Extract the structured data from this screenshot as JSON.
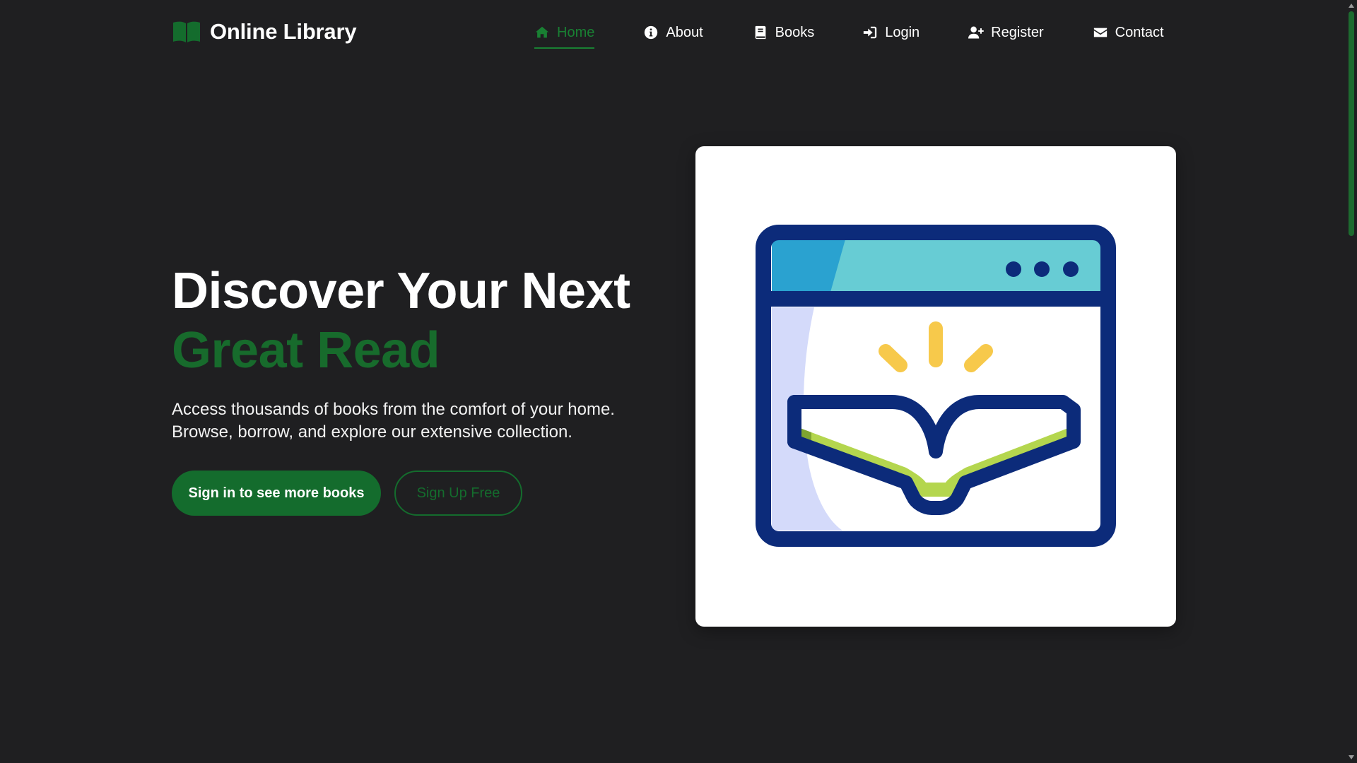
{
  "brand": {
    "name": "Online Library",
    "icon": "book-open-icon"
  },
  "nav": {
    "items": [
      {
        "label": "Home",
        "icon": "home-icon",
        "active": true
      },
      {
        "label": "About",
        "icon": "info-circle-icon",
        "active": false
      },
      {
        "label": "Books",
        "icon": "book-icon",
        "active": false
      },
      {
        "label": "Login",
        "icon": "sign-in-icon",
        "active": false
      },
      {
        "label": "Register",
        "icon": "user-plus-icon",
        "active": false
      },
      {
        "label": "Contact",
        "icon": "envelope-icon",
        "active": false
      }
    ]
  },
  "hero": {
    "title_line1": "Discover Your Next",
    "title_line2": "Great Read",
    "subtitle_line1": "Access thousands of books from the comfort of your home.",
    "subtitle_line2": "Browse, borrow, and explore our extensive collection.",
    "primary_button": "Sign in to see more books",
    "secondary_button": "Sign Up Free",
    "illustration": "browser-window-open-book-illustration"
  },
  "colors": {
    "background": "#1f1f21",
    "accent": "#146c2d",
    "text": "#ffffff",
    "card": "#ffffff"
  }
}
